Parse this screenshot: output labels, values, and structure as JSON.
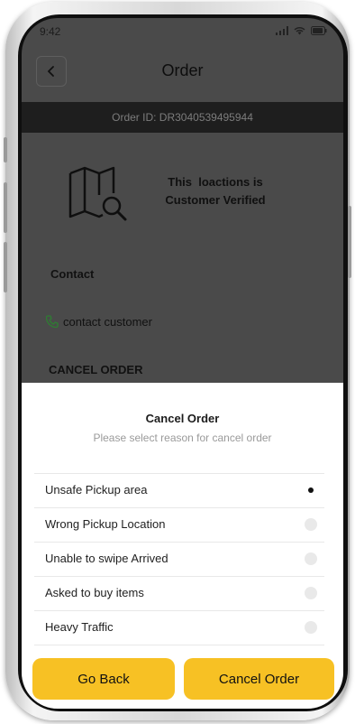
{
  "status_bar": {
    "time": "9:42"
  },
  "header": {
    "title": "Order"
  },
  "order": {
    "id_text": "Order ID: DR3040539495944"
  },
  "location": {
    "verified_line1": "This  loactions is",
    "verified_line2": "Customer Verified"
  },
  "contact": {
    "section_label": "Contact",
    "link_text": "contact customer"
  },
  "cancel_section": {
    "heading": "CANCEL ORDER"
  },
  "sheet": {
    "title": "Cancel Order",
    "subtitle": "Please select reason for cancel order",
    "reasons": [
      {
        "label": "Unsafe Pickup area",
        "selected": true
      },
      {
        "label": "Wrong Pickup Location",
        "selected": false
      },
      {
        "label": "Unable to swipe Arrived",
        "selected": false
      },
      {
        "label": "Asked to buy items",
        "selected": false
      },
      {
        "label": "Heavy Traffic",
        "selected": false
      }
    ],
    "go_back_label": "Go Back",
    "cancel_order_label": "Cancel Order"
  },
  "colors": {
    "accent": "#f7c124",
    "overlay": "#4a4a4a",
    "order_bar": "#1e1e1e",
    "phone_icon": "#2e7d32"
  },
  "icons": [
    "back-arrow-icon",
    "map-search-icon",
    "phone-icon",
    "signal-icon",
    "wifi-icon",
    "battery-icon"
  ]
}
